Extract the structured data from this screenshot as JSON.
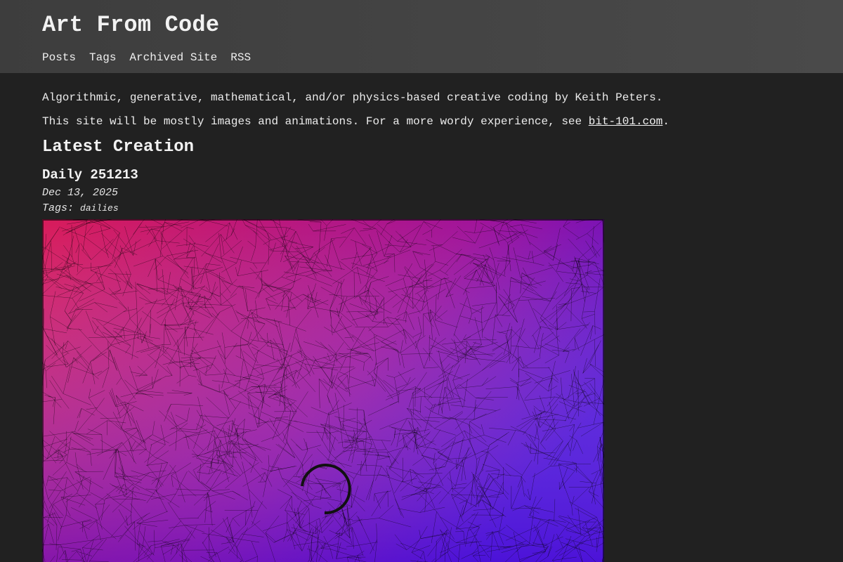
{
  "site": {
    "title": "Art From Code"
  },
  "nav": {
    "items": [
      {
        "label": "Posts"
      },
      {
        "label": "Tags"
      },
      {
        "label": "Archived Site"
      },
      {
        "label": "RSS"
      }
    ]
  },
  "intro": {
    "line1": "Algorithmic, generative, mathematical, and/or physics-based creative coding by Keith Peters.",
    "line2_prefix": "This site will be mostly images and animations. For a more wordy experience, see ",
    "line2_link": "bit-101.com",
    "line2_suffix": "."
  },
  "latest": {
    "heading": "Latest Creation",
    "post": {
      "title": "Daily 251213",
      "date": "Dec 13, 2025",
      "tags_label": "Tags:",
      "tags": [
        "dailies"
      ]
    }
  },
  "artwork": {
    "colors": {
      "top_left": "#d81b5a",
      "top_right": "#a0149a",
      "bottom_left": "#8a18a8",
      "bottom_right": "#4a10d8",
      "lines": "#000000",
      "background": "#212121",
      "header_background": "#444444"
    },
    "loading_indicator_icon": "spinner-icon"
  }
}
